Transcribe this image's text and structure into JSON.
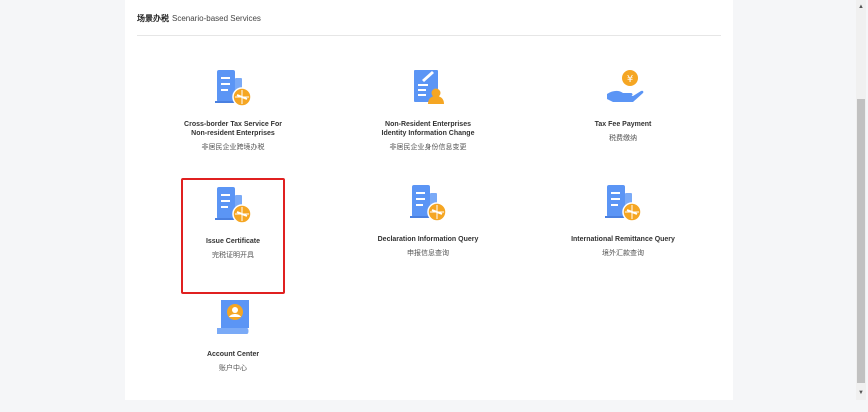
{
  "section": {
    "title_zh": "场景办税",
    "title_en": "Scenario-based Services"
  },
  "services": [
    {
      "en": "Cross-border Tax Service For Non-resident Enterprises",
      "zh": "非居民企业跨境办税",
      "icon": "building-globe-icon"
    },
    {
      "en": "Non-Resident Enterprises Identity Information Change",
      "zh": "非居民企业身份信息变更",
      "icon": "document-user-icon"
    },
    {
      "en": "Tax Fee Payment",
      "zh": "税费缴纳",
      "icon": "hand-yuan-coin-icon"
    },
    {
      "en": "Issue Certificate",
      "zh": "完税证明开具",
      "icon": "building-globe-icon",
      "selected": true
    },
    {
      "en": "Declaration Information Query",
      "zh": "申报信息查询",
      "icon": "building-globe-icon"
    },
    {
      "en": "International Remittance Query",
      "zh": "境外汇款查询",
      "icon": "building-globe-icon"
    },
    {
      "en": "Account Center",
      "zh": "账户中心",
      "icon": "account-scroll-icon"
    }
  ],
  "colors": {
    "blue": "#4f8ef5",
    "orange": "#f5a623",
    "selected_border": "#e02020"
  }
}
